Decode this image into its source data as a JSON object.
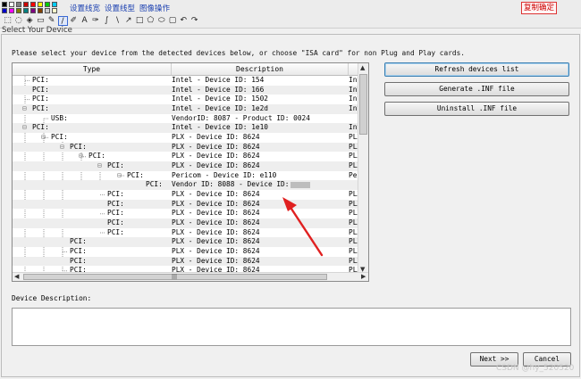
{
  "toolbar": {
    "links": [
      "设置线宽",
      "设置线型",
      "图像操作"
    ],
    "copy_button": "复制确定",
    "tools": [
      "rect-select-icon",
      "lasso-icon",
      "fill-icon",
      "eraser-icon",
      "picker-icon",
      "pencil-icon",
      "brush-icon",
      "text-icon",
      "marker-icon",
      "curve-icon",
      "line-icon",
      "arrow-icon",
      "rectangle-icon",
      "polygon-icon",
      "ellipse-icon",
      "rounded-rect-icon",
      "undo-icon",
      "redo-icon"
    ],
    "tool_glyphs": [
      "⬚",
      "◌",
      "◈",
      "▭",
      "✎",
      "/",
      "✐",
      "A",
      "✑",
      "∫",
      "\\",
      "↗",
      "□",
      "⬠",
      "⬭",
      "▢",
      "↶",
      "↷"
    ],
    "selected_tool_index": 5
  },
  "dialog": {
    "title": "Select Your Device",
    "instruction": "Please select your device from the detected devices below, or choose \"ISA card\" for non Plug and Play cards.",
    "columns": [
      "Type",
      "Description"
    ],
    "rows": [
      {
        "type": "PCI:",
        "desc": "Intel - Device ID: 154",
        "extra": "Intel"
      },
      {
        "type": "PCI:",
        "desc": "Intel - Device ID: 166",
        "extra": "Intel"
      },
      {
        "type": "PCI:",
        "desc": "Intel - Device ID: 1502",
        "extra": "Intel"
      },
      {
        "type": "PCI:",
        "desc": "Intel - Device ID: 1e2d",
        "extra": "Intel"
      },
      {
        "type": "USB:",
        "desc": "VendorID: 8087 - Product ID: 0024",
        "extra": ""
      },
      {
        "type": "PCI:",
        "desc": "Intel - Device ID: 1e10",
        "extra": "Intel"
      },
      {
        "type": "PCI:",
        "desc": "PLX - Device ID: 8624",
        "extra": "PLX"
      },
      {
        "type": "PCI:",
        "desc": "PLX - Device ID: 8624",
        "extra": "PLX"
      },
      {
        "type": "PCI:",
        "desc": "PLX - Device ID: 8624",
        "extra": "PLX"
      },
      {
        "type": "PCI:",
        "desc": "PLX - Device ID: 8624",
        "extra": "PLX"
      },
      {
        "type": "PCI:",
        "desc": "Pericom - Device ID: e110",
        "extra": "Peric"
      },
      {
        "type": "PCI:",
        "desc": "Vendor ID: 8088 - Device ID:",
        "extra": ""
      },
      {
        "type": "PCI:",
        "desc": "PLX - Device ID: 8624",
        "extra": "PLX"
      },
      {
        "type": "PCI:",
        "desc": "PLX - Device ID: 8624",
        "extra": "PLX"
      },
      {
        "type": "PCI:",
        "desc": "PLX - Device ID: 8624",
        "extra": "PLX"
      },
      {
        "type": "PCI:",
        "desc": "PLX - Device ID: 8624",
        "extra": "PLX"
      },
      {
        "type": "PCI:",
        "desc": "PLX - Device ID: 8624",
        "extra": "PLX"
      },
      {
        "type": "PCI:",
        "desc": "PLX - Device ID: 8624",
        "extra": "PLX"
      },
      {
        "type": "PCI:",
        "desc": "PLX - Device ID: 8624",
        "extra": "PLX"
      },
      {
        "type": "PCI:",
        "desc": "PLX - Device ID: 8624",
        "extra": "PLX"
      },
      {
        "type": "PCI:",
        "desc": "PLX - Device ID: 8624",
        "extra": "PLX"
      },
      {
        "type": "PCI:",
        "desc": "PLX - Device ID: 8624",
        "extra": "PLX"
      }
    ],
    "buttons": {
      "refresh": "Refresh devices list",
      "generate": "Generate .INF file",
      "uninstall": "Uninstall .INF file",
      "next": "Next >>",
      "cancel": "Cancel"
    },
    "description_label": "Device Description:"
  },
  "watermark": "CSDN @hy_520520",
  "colors": {
    "annotation_arrow": "#e02020",
    "link": "#1a3fb0"
  }
}
